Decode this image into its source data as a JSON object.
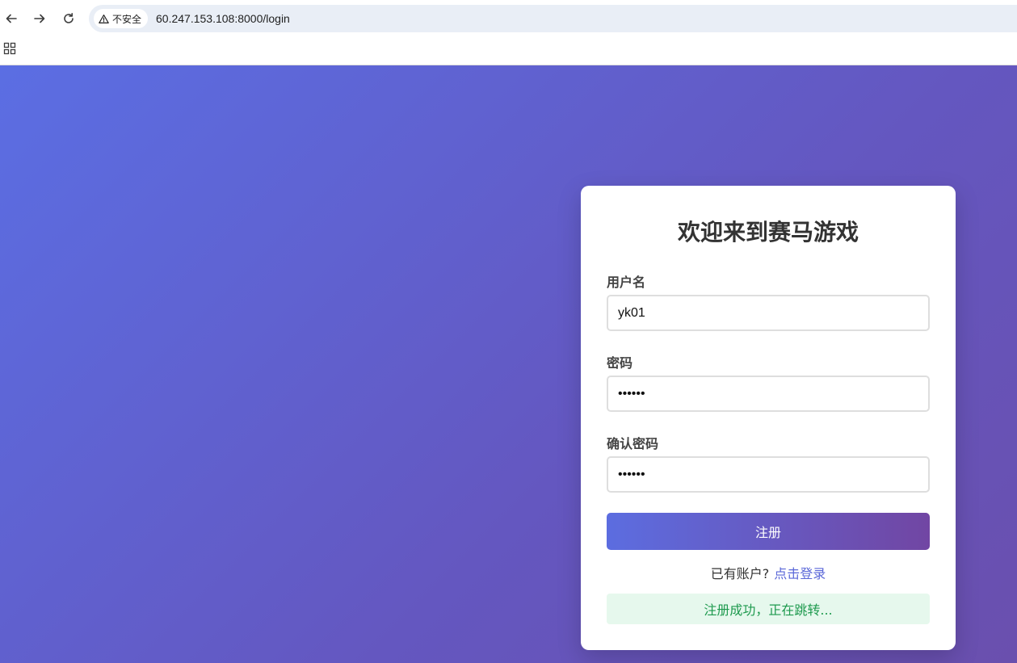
{
  "browser": {
    "security_label": "不安全",
    "url": "60.247.153.108:8000/login",
    "icons": [
      "back-arrow-icon",
      "forward-arrow-icon",
      "reload-icon",
      "warning-icon",
      "apps-grid-icon"
    ]
  },
  "card": {
    "title": "欢迎来到赛马游戏",
    "username": {
      "label": "用户名",
      "value": "yk01"
    },
    "password": {
      "label": "密码",
      "value": "••••••"
    },
    "confirm_password": {
      "label": "确认密码",
      "value": "••••••"
    },
    "submit_label": "注册",
    "switch_prompt": "已有账户?",
    "switch_link": "点击登录",
    "status_message": "注册成功，正在跳转..."
  },
  "colors": {
    "bg_start": "#5b6ee3",
    "bg_end": "#6a4fae",
    "button_start": "#5c6de0",
    "button_end": "#7146a3",
    "link": "#5a67d8",
    "success_bg": "#e6f8ed",
    "success_text": "#1e9a4e"
  }
}
